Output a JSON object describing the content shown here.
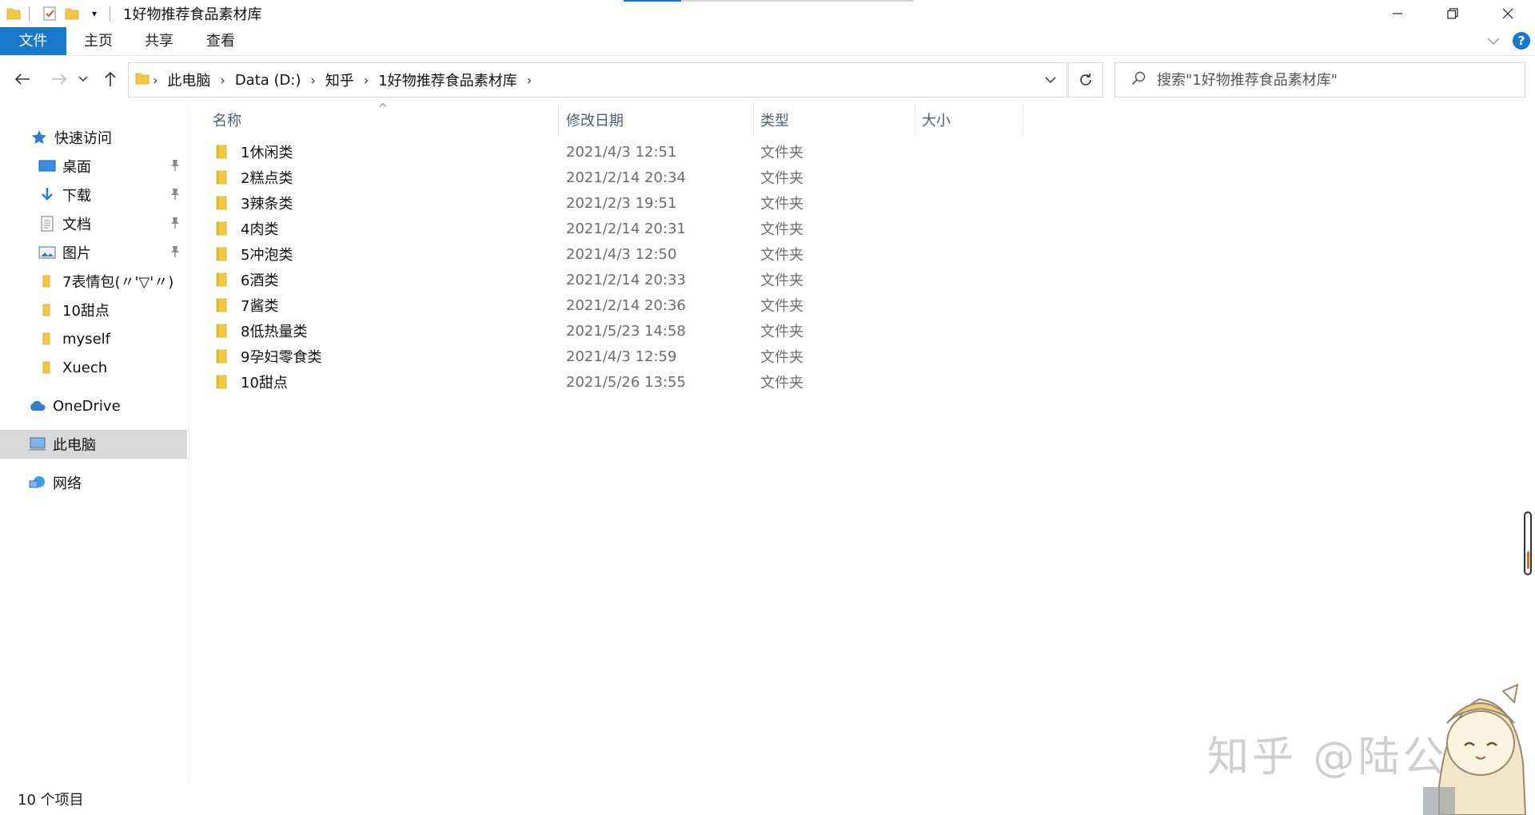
{
  "window": {
    "title": "1好物推荐食品素材库"
  },
  "ribbon": {
    "tabs": [
      "文件",
      "主页",
      "共享",
      "查看"
    ]
  },
  "nav": {
    "breadcrumb": [
      "此电脑",
      "Data (D:)",
      "知乎",
      "1好物推荐食品素材库"
    ],
    "search_placeholder": "搜索\"1好物推荐食品素材库\""
  },
  "sidebar": {
    "quick_access": "快速访问",
    "items": [
      {
        "label": "桌面",
        "icon": "desktop-icon",
        "pinned": true
      },
      {
        "label": "下载",
        "icon": "download-icon",
        "pinned": true
      },
      {
        "label": "文档",
        "icon": "document-icon",
        "pinned": true
      },
      {
        "label": "图片",
        "icon": "picture-icon",
        "pinned": true
      },
      {
        "label": "7表情包(〃'▽'〃)",
        "icon": "folder-icon",
        "pinned": false
      },
      {
        "label": "10甜点",
        "icon": "folder-icon",
        "pinned": false
      },
      {
        "label": "myself",
        "icon": "folder-icon",
        "pinned": false
      },
      {
        "label": "Xuech",
        "icon": "folder-icon",
        "pinned": false
      }
    ],
    "onedrive": "OneDrive",
    "this_pc": "此电脑",
    "network": "网络"
  },
  "table": {
    "columns": [
      "名称",
      "修改日期",
      "类型",
      "大小"
    ],
    "rows": [
      {
        "name": "1休闲类",
        "date": "2021/4/3 12:51",
        "type": "文件夹"
      },
      {
        "name": "2糕点类",
        "date": "2021/2/14 20:34",
        "type": "文件夹"
      },
      {
        "name": "3辣条类",
        "date": "2021/2/3 19:51",
        "type": "文件夹"
      },
      {
        "name": "4肉类",
        "date": "2021/2/14 20:31",
        "type": "文件夹"
      },
      {
        "name": "5冲泡类",
        "date": "2021/4/3 12:50",
        "type": "文件夹"
      },
      {
        "name": "6酒类",
        "date": "2021/2/14 20:33",
        "type": "文件夹"
      },
      {
        "name": "7酱类",
        "date": "2021/2/14 20:36",
        "type": "文件夹"
      },
      {
        "name": "8低热量类",
        "date": "2021/5/23 14:58",
        "type": "文件夹"
      },
      {
        "name": "9孕妇零食类",
        "date": "2021/4/3 12:59",
        "type": "文件夹"
      },
      {
        "name": "10甜点",
        "date": "2021/5/26 13:55",
        "type": "文件夹"
      }
    ]
  },
  "status": {
    "item_count": "10 个项目"
  },
  "watermark": "知乎 @陆公子",
  "colors": {
    "accent": "#1979ca",
    "folder": "#f5c843",
    "selected_bg": "#d9d9d9",
    "header_text": "#4c607a"
  }
}
